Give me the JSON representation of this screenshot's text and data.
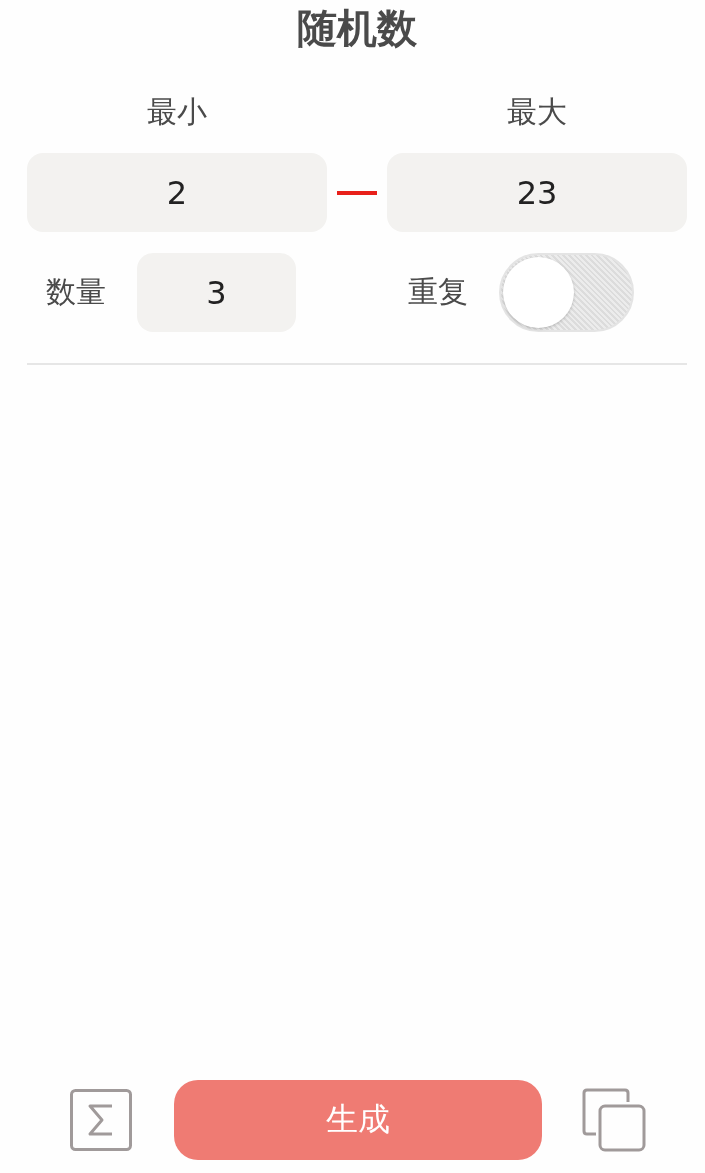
{
  "title": "随机数",
  "range": {
    "min_label": "最小",
    "max_label": "最大",
    "min_value": "2",
    "max_value": "23"
  },
  "count": {
    "label": "数量",
    "value": "3"
  },
  "repeat": {
    "label": "重复",
    "on": false
  },
  "generate_button": "生成"
}
